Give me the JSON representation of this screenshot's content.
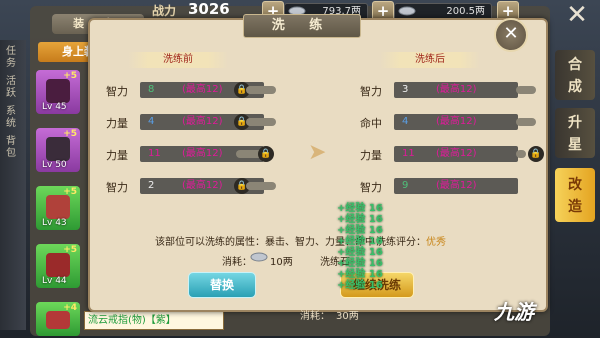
{
  "background_panel": {
    "title": "装 备",
    "tab": "身上装备",
    "left_strip_text": [
      "任务",
      "活跃",
      "系统",
      "背包"
    ]
  },
  "topbar": {
    "combat_power_label": "战力",
    "combat_power_value": "3026",
    "resource_1": "793.7两",
    "resource_2": "200.5两",
    "plus_label": "+"
  },
  "side_tabs": [
    "合成",
    "升星",
    "改造"
  ],
  "items": [
    {
      "level": "Lv 45",
      "plus": "+5"
    },
    {
      "level": "Lv 50",
      "plus": "+5"
    },
    {
      "level": "Lv 43",
      "plus": "+5"
    },
    {
      "level": "Lv 44",
      "plus": "+5"
    },
    {
      "level": "",
      "plus": "+4"
    }
  ],
  "bottom_item_label": "流云戒指(物)【紫】",
  "dialog": {
    "title": "洗 练",
    "close_label": "✕",
    "before_header": "洗练前",
    "after_header": "洗练后",
    "before_rows": [
      {
        "label": "智力",
        "value": "8",
        "max": "(最高12)"
      },
      {
        "label": "力量",
        "value": "4",
        "max": "(最高12)"
      },
      {
        "label": "力量",
        "value": "11",
        "max": "(最高12)"
      },
      {
        "label": "智力",
        "value": "2",
        "max": "(最高12)"
      }
    ],
    "after_rows": [
      {
        "label": "智力",
        "value": "3",
        "max": "(最高12)"
      },
      {
        "label": "命中",
        "value": "4",
        "max": "(最高12)"
      },
      {
        "label": "力量",
        "value": "11",
        "max": "(最高12)"
      },
      {
        "label": "智力",
        "value": "9",
        "max": "(最高12)"
      }
    ],
    "info_text": "该部位可以洗练的属性：暴击、智力、力量、命中",
    "score_label": "洗练评分：",
    "score_value": "优秀",
    "cost_label_1": "消耗：",
    "cost_value_1": "10两",
    "cost_label_2": "洗练石",
    "cost_label_3": "消耗：",
    "cost_value_3": "30两",
    "replace_button": "替换",
    "continue_button": "继续洗练",
    "float_stats": [
      "+经验 16",
      "+经验 16",
      "+经验 16",
      "+经验 16",
      "+经验 16",
      "+经验 16",
      "+经验 16",
      "+经验 16"
    ]
  },
  "watermark": "九游",
  "colors": {
    "accent_yellow": "#e4a421",
    "max_pink": "#e01a9a",
    "good_orange": "#c8861a",
    "float_green": "#38c06a"
  }
}
